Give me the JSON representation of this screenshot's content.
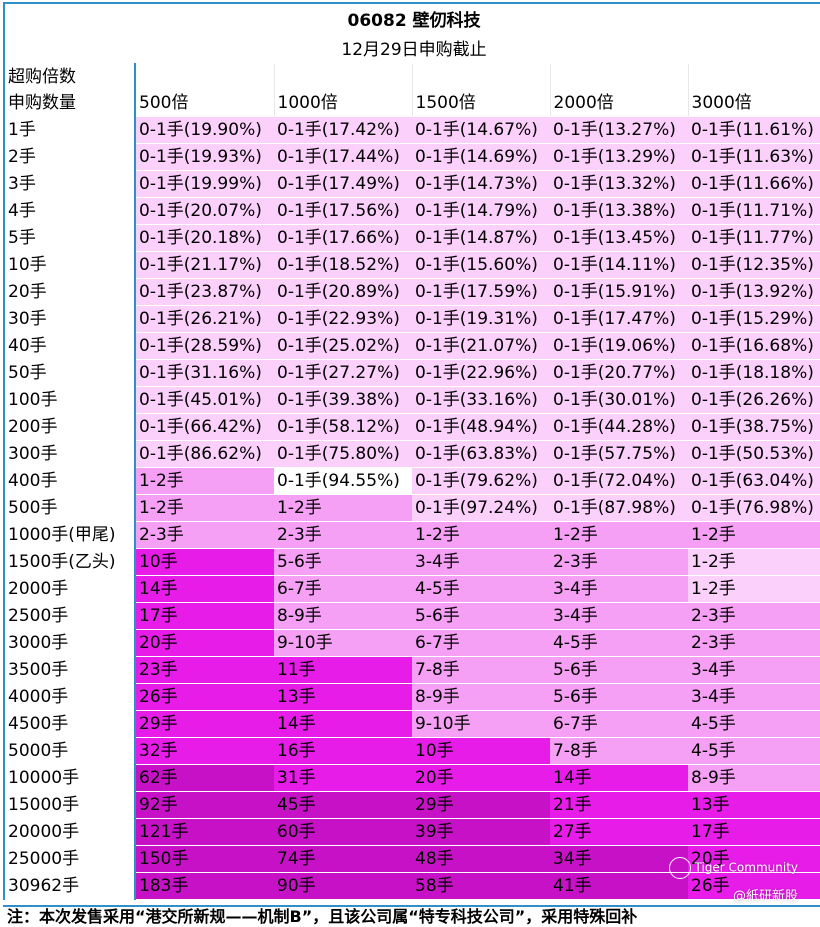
{
  "title": {
    "code_name": "06082 壁仞科技",
    "subtitle": "12月29日申购截止"
  },
  "header": {
    "corner_line1": "超购倍数",
    "corner_line2": "申购数量",
    "columns": [
      "500倍",
      "1000倍",
      "1500倍",
      "2000倍",
      "3000倍"
    ]
  },
  "rows": [
    {
      "label": "1手",
      "cells": [
        "0-1手(19.90%)",
        "0-1手(17.42%)",
        "0-1手(14.67%)",
        "0-1手(13.27%)",
        "0-1手(11.61%)"
      ]
    },
    {
      "label": "2手",
      "cells": [
        "0-1手(19.93%)",
        "0-1手(17.44%)",
        "0-1手(14.69%)",
        "0-1手(13.29%)",
        "0-1手(11.63%)"
      ]
    },
    {
      "label": "3手",
      "cells": [
        "0-1手(19.99%)",
        "0-1手(17.49%)",
        "0-1手(14.73%)",
        "0-1手(13.32%)",
        "0-1手(11.66%)"
      ]
    },
    {
      "label": "4手",
      "cells": [
        "0-1手(20.07%)",
        "0-1手(17.56%)",
        "0-1手(14.79%)",
        "0-1手(13.38%)",
        "0-1手(11.71%)"
      ]
    },
    {
      "label": "5手",
      "cells": [
        "0-1手(20.18%)",
        "0-1手(17.66%)",
        "0-1手(14.87%)",
        "0-1手(13.45%)",
        "0-1手(11.77%)"
      ]
    },
    {
      "label": "10手",
      "cells": [
        "0-1手(21.17%)",
        "0-1手(18.52%)",
        "0-1手(15.60%)",
        "0-1手(14.11%)",
        "0-1手(12.35%)"
      ]
    },
    {
      "label": "20手",
      "cells": [
        "0-1手(23.87%)",
        "0-1手(20.89%)",
        "0-1手(17.59%)",
        "0-1手(15.91%)",
        "0-1手(13.92%)"
      ]
    },
    {
      "label": "30手",
      "cells": [
        "0-1手(26.21%)",
        "0-1手(22.93%)",
        "0-1手(19.31%)",
        "0-1手(17.47%)",
        "0-1手(15.29%)"
      ]
    },
    {
      "label": "40手",
      "cells": [
        "0-1手(28.59%)",
        "0-1手(25.02%)",
        "0-1手(21.07%)",
        "0-1手(19.06%)",
        "0-1手(16.68%)"
      ]
    },
    {
      "label": "50手",
      "cells": [
        "0-1手(31.16%)",
        "0-1手(27.27%)",
        "0-1手(22.96%)",
        "0-1手(20.77%)",
        "0-1手(18.18%)"
      ]
    },
    {
      "label": "100手",
      "cells": [
        "0-1手(45.01%)",
        "0-1手(39.38%)",
        "0-1手(33.16%)",
        "0-1手(30.01%)",
        "0-1手(26.26%)"
      ]
    },
    {
      "label": "200手",
      "cells": [
        "0-1手(66.42%)",
        "0-1手(58.12%)",
        "0-1手(48.94%)",
        "0-1手(44.28%)",
        "0-1手(38.75%)"
      ]
    },
    {
      "label": "300手",
      "cells": [
        "0-1手(86.62%)",
        "0-1手(75.80%)",
        "0-1手(63.83%)",
        "0-1手(57.75%)",
        "0-1手(50.53%)"
      ]
    },
    {
      "label": "400手",
      "cells": [
        "1-2手",
        "0-1手(94.55%)",
        "0-1手(79.62%)",
        "0-1手(72.04%)",
        "0-1手(63.04%)"
      ]
    },
    {
      "label": "500手",
      "cells": [
        "1-2手",
        "1-2手",
        "0-1手(97.24%)",
        "0-1手(87.98%)",
        "0-1手(76.98%)"
      ]
    },
    {
      "label": "1000手(甲尾)",
      "cells": [
        "2-3手",
        "2-3手",
        "1-2手",
        "1-2手",
        "1-2手"
      ]
    },
    {
      "label": "1500手(乙头)",
      "cells": [
        "10手",
        "5-6手",
        "3-4手",
        "2-3手",
        "1-2手"
      ]
    },
    {
      "label": "2000手",
      "cells": [
        "14手",
        "6-7手",
        "4-5手",
        "3-4手",
        "1-2手"
      ]
    },
    {
      "label": "2500手",
      "cells": [
        "17手",
        "8-9手",
        "5-6手",
        "3-4手",
        "2-3手"
      ]
    },
    {
      "label": "3000手",
      "cells": [
        "20手",
        "9-10手",
        "6-7手",
        "4-5手",
        "2-3手"
      ]
    },
    {
      "label": "3500手",
      "cells": [
        "23手",
        "11手",
        "7-8手",
        "5-6手",
        "3-4手"
      ]
    },
    {
      "label": "4000手",
      "cells": [
        "26手",
        "13手",
        "8-9手",
        "5-6手",
        "3-4手"
      ]
    },
    {
      "label": "4500手",
      "cells": [
        "29手",
        "14手",
        "9-10手",
        "6-7手",
        "4-5手"
      ]
    },
    {
      "label": "5000手",
      "cells": [
        "32手",
        "16手",
        "10手",
        "7-8手",
        "4-5手"
      ]
    },
    {
      "label": "10000手",
      "cells": [
        "62手",
        "31手",
        "20手",
        "14手",
        "8-9手"
      ]
    },
    {
      "label": "15000手",
      "cells": [
        "92手",
        "45手",
        "29手",
        "21手",
        "13手"
      ]
    },
    {
      "label": "20000手",
      "cells": [
        "121手",
        "60手",
        "39手",
        "27手",
        "17手"
      ]
    },
    {
      "label": "25000手",
      "cells": [
        "150手",
        "74手",
        "48手",
        "34手",
        "20手"
      ]
    },
    {
      "label": "30962手",
      "cells": [
        "183手",
        "90手",
        "58手",
        "41手",
        "26手"
      ]
    }
  ],
  "footnote": "注：本次发售采用“港交所新规——机制B”，且该公司属“特专科技公司”，采用特殊回补",
  "watermark": {
    "brand": "Tiger Community",
    "handle": "@紙研新股"
  },
  "palette": {
    "header_border": "#2e8fc9",
    "separator": "#e8a33a",
    "white": "#ffffff",
    "pale_pink": "#fbd0fb",
    "light_magenta": "#f59ff5",
    "magenta": "#f062f0",
    "bright_magenta": "#e81ce8",
    "purple_magenta": "#c711c7"
  },
  "shading": [
    [
      1,
      1,
      1,
      1,
      1
    ],
    [
      1,
      1,
      1,
      1,
      1
    ],
    [
      1,
      1,
      1,
      1,
      1
    ],
    [
      1,
      1,
      1,
      1,
      1
    ],
    [
      1,
      1,
      1,
      1,
      1
    ],
    [
      1,
      1,
      1,
      1,
      1
    ],
    [
      1,
      1,
      1,
      1,
      1
    ],
    [
      1,
      1,
      1,
      1,
      1
    ],
    [
      1,
      1,
      1,
      1,
      1
    ],
    [
      1,
      1,
      1,
      1,
      1
    ],
    [
      1,
      1,
      1,
      1,
      1
    ],
    [
      1,
      1,
      1,
      1,
      1
    ],
    [
      1,
      1,
      1,
      1,
      1
    ],
    [
      2,
      0,
      1,
      1,
      1
    ],
    [
      2,
      2,
      1,
      1,
      1
    ],
    [
      2,
      2,
      2,
      2,
      2
    ],
    [
      3,
      2,
      2,
      2,
      1
    ],
    [
      3,
      2,
      2,
      2,
      1
    ],
    [
      3,
      2,
      2,
      2,
      2
    ],
    [
      3,
      2,
      2,
      2,
      2
    ],
    [
      3,
      3,
      2,
      2,
      2
    ],
    [
      3,
      3,
      2,
      2,
      2
    ],
    [
      3,
      3,
      2,
      2,
      2
    ],
    [
      3,
      3,
      3,
      2,
      2
    ],
    [
      5,
      3,
      3,
      3,
      2
    ],
    [
      5,
      4,
      4,
      3,
      3
    ],
    [
      5,
      4,
      4,
      3,
      3
    ],
    [
      5,
      4,
      4,
      4,
      3
    ],
    [
      5,
      4,
      4,
      4,
      3
    ]
  ]
}
